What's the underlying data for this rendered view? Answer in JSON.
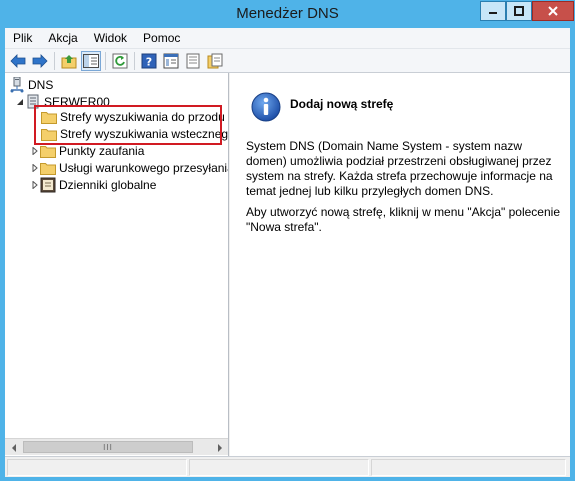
{
  "window": {
    "title": "Menedżer DNS"
  },
  "menu": [
    "Plik",
    "Akcja",
    "Widok",
    "Pomoc"
  ],
  "toolbar": {
    "buttons": [
      "back-icon",
      "forward-icon",
      "up-folder-icon",
      "show-hide-tree-icon",
      "refresh-icon",
      "help-icon",
      "properties-icon",
      "list-view-icon",
      "export-icon"
    ]
  },
  "tree": {
    "root": "DNS",
    "server": "SERWER00",
    "items": [
      "Strefy wyszukiwania do przodu",
      "Strefy wyszukiwania wstecznego",
      "Punkty zaufania",
      "Usługi warunkowego przesyłania d",
      "Dzienniki globalne"
    ]
  },
  "scrollbar": {
    "grip": "III"
  },
  "detail": {
    "title": "Dodaj nową strefę",
    "paragraph1": "System DNS (Domain Name System - system nazw domen) umożliwia podział przestrzeni obsługiwanej przez system na strefy. Każda strefa przechowuje informacje na temat jednej lub kilku przyległych domen DNS.",
    "paragraph2": "Aby utworzyć nową strefę, kliknij w menu \"Akcja\" polecenie \"Nowa strefa\"."
  },
  "colors": {
    "frame": "#4fb3e8",
    "close": "#c7504a",
    "highlight": "#d11a22",
    "folder": "#f4cf6a"
  }
}
